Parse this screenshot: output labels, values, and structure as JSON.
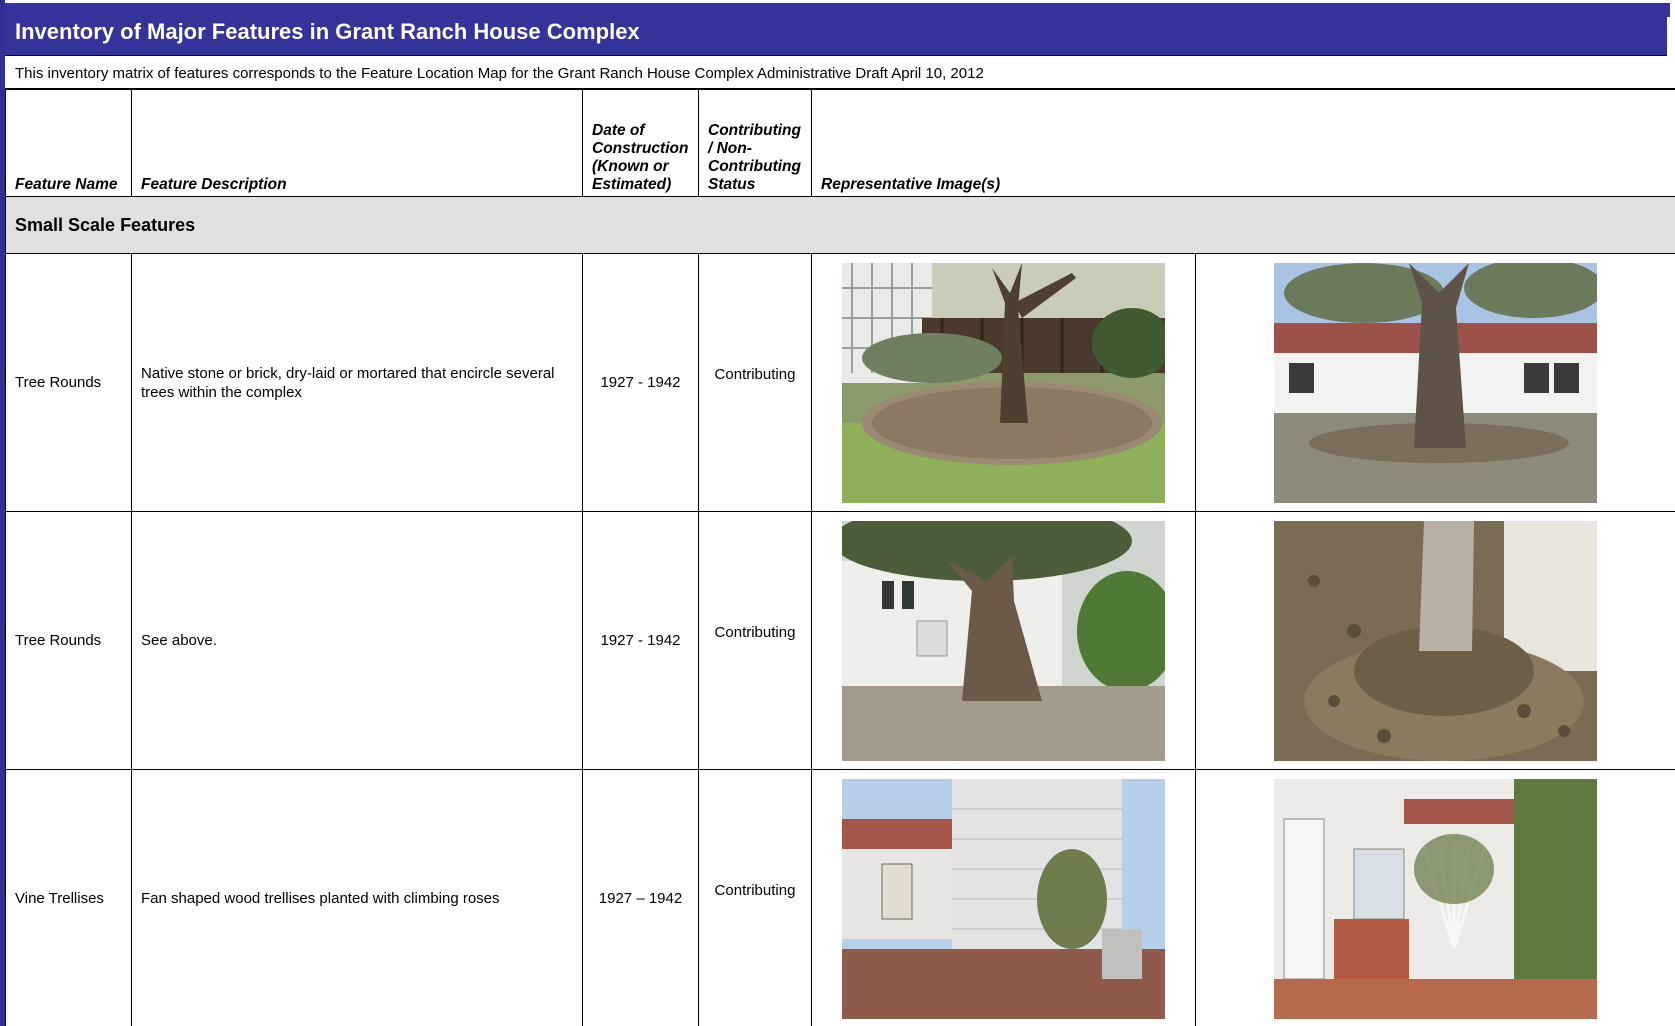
{
  "document": {
    "title": "Inventory of Major Features in Grant Ranch House Complex",
    "subtitle": "This inventory matrix of features corresponds to the Feature Location Map for the Grant Ranch House Complex  Administrative Draft April 10, 2012"
  },
  "table": {
    "headers": {
      "feature_name": "Feature Name",
      "feature_description": "Feature Description",
      "date": "Date of Construction (Known or Estimated)",
      "status": "Contributing / Non-Contributing Status",
      "images": "Representative Image(s)"
    },
    "section_title": "Small Scale Features",
    "rows": [
      {
        "name": "Tree Rounds",
        "description": "Native stone or brick, dry-laid or mortared that  encircle several trees within the complex",
        "date": "1927 - 1942",
        "status": "Contributing",
        "images": [
          "photo-tree-round-trellis-fence",
          "photo-tree-round-house-porch"
        ]
      },
      {
        "name": "Tree Rounds",
        "description": "See above.",
        "date": "1927 - 1942",
        "status": "Contributing",
        "images": [
          "photo-large-oak-white-house",
          "photo-tree-base-leaves"
        ]
      },
      {
        "name": "Vine Trellises",
        "description": "Fan shaped wood trellises planted with climbing roses",
        "date": "1927 – 1942",
        "status": "Contributing",
        "images": [
          "photo-house-corner-trellis",
          "photo-fan-trellis-bay-window"
        ]
      }
    ]
  },
  "colors": {
    "title_bar": "#333399",
    "section_bg": "#e0e0e0",
    "frame": "#2e3192"
  }
}
